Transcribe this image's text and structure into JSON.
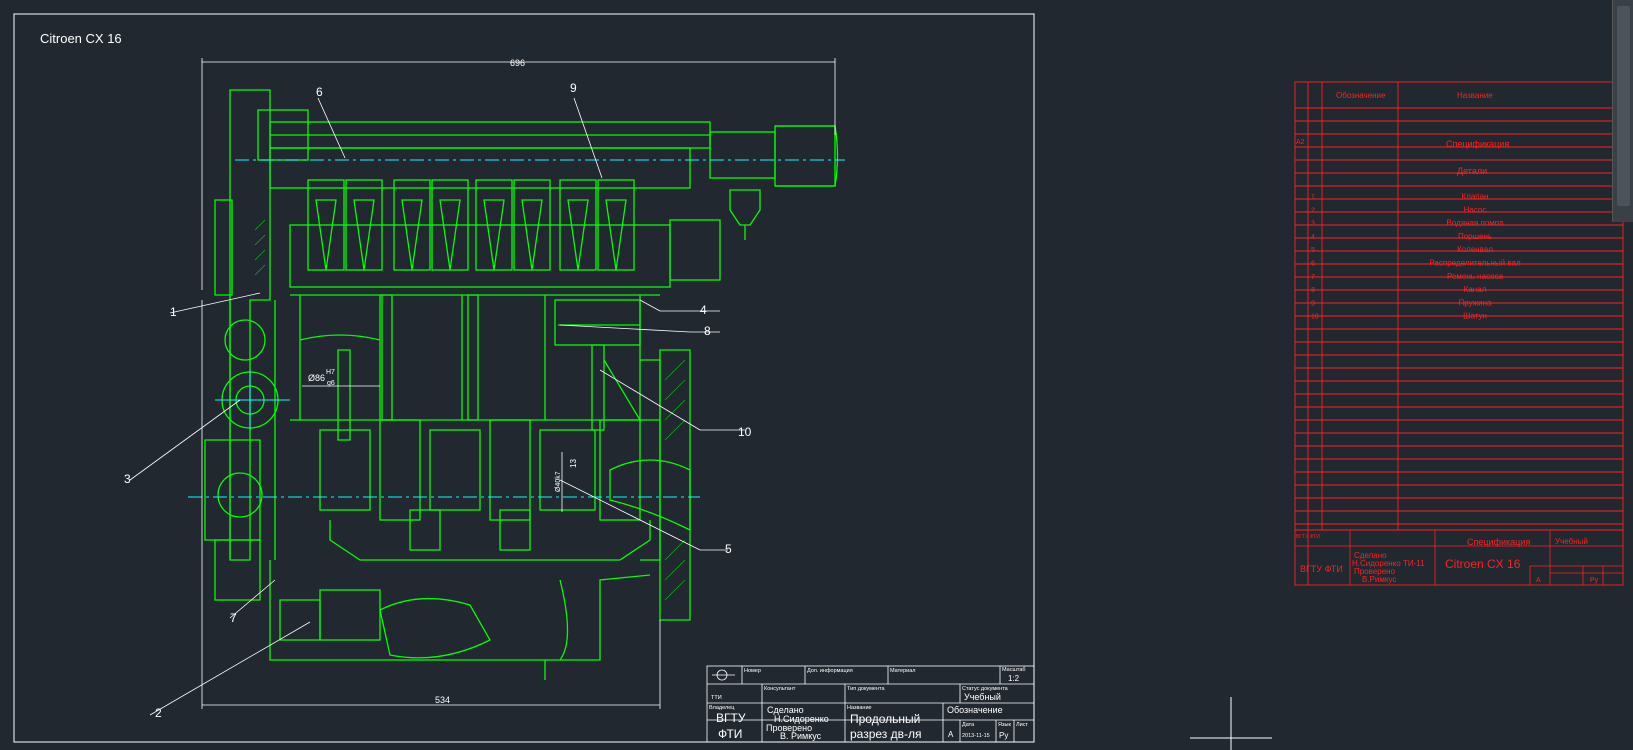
{
  "drawing": {
    "title": "Citroen CX 16",
    "dim_top": "696",
    "dim_bottom": "534",
    "bore_dim": "Ø86",
    "bore_fit_top": "H7",
    "bore_fit_bottom": "g6",
    "small_dim": "Ø40k7",
    "small_dim2": "13",
    "callouts": [
      "1",
      "2",
      "3",
      "4",
      "5",
      "6",
      "7",
      "8",
      "9",
      "10"
    ]
  },
  "title_block": {
    "nomer_label": "Номер",
    "dop_info_label": "Доп. информация",
    "material_label": "Материал",
    "masshtab_label": "Масштаб",
    "scale": "1:2",
    "konsultant_label": "Консультант",
    "tip_doc_label": "Тип документа",
    "status_label": "Статус документа",
    "status_value": "Учебный",
    "vladelets_label": "Владелец",
    "nazvanie_label": "Название",
    "oboznachenie_label": "Обозначение",
    "org_line1": "ВГТУ",
    "org_line2": "ФТИ",
    "sdelano": "Сделано",
    "sdelano_name": "Н.Сидоренко",
    "provereno": "Проверено",
    "provereno_name": "В. Римкус",
    "name_line1": "Продольный",
    "name_line2": "разрез дв-ля",
    "data_label": "Дата",
    "date_value": "2013-11-15",
    "list_letter": "А",
    "yaz_label": "Язык",
    "yaz_value": "Ру",
    "list_label": "Лист",
    "small_org_top": "ВГТУ ФТИ",
    "small_org": "ТТИ"
  },
  "spec": {
    "col_designation": "Обозначение",
    "col_name": "Название",
    "format_mark": "А2",
    "spec_heading": "Спецификация",
    "details_heading": "Детали",
    "items": [
      {
        "pos": "1",
        "name": "Клапан"
      },
      {
        "pos": "2",
        "name": "Насос"
      },
      {
        "pos": "3",
        "name": "Водяная помпа"
      },
      {
        "pos": "4",
        "name": "Поршень"
      },
      {
        "pos": "5",
        "name": "Коленвал"
      },
      {
        "pos": "6",
        "name": "Распределительный вал"
      },
      {
        "pos": "7",
        "name": "Ремень насоса"
      },
      {
        "pos": "8",
        "name": "Канал"
      },
      {
        "pos": "9",
        "name": "Пружина"
      },
      {
        "pos": "10",
        "name": "Шатун"
      }
    ],
    "tb_doc_type": "Спецификация",
    "tb_status": "Учебный",
    "tb_org": "ВГТУ ФТИ",
    "tb_made": "Сделано",
    "tb_made_name": "Н.Сидоренко ТИ-11",
    "tb_checked": "Проверено",
    "tb_checked_name": "В.Римкус",
    "tb_name": "Citroen CX 16",
    "tb_letter": "А",
    "tb_lang": "Ру"
  },
  "colors": {
    "background": "#212830",
    "lines": "#ffffff",
    "engine": "#00ff00",
    "centerline": "#00ffff",
    "spec": "#ff2020"
  }
}
